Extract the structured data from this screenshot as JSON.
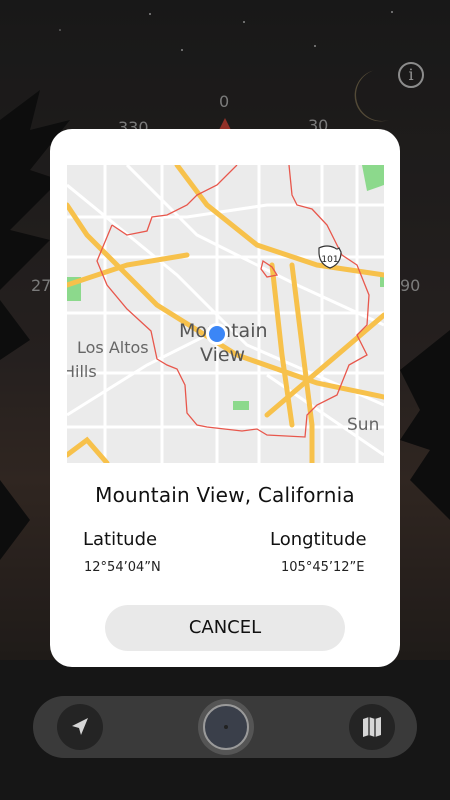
{
  "background": {
    "compass_ticks": [
      "0",
      "330",
      "30",
      "27",
      "90"
    ]
  },
  "info_icon": "info-icon",
  "dialog": {
    "map": {
      "labels": [
        "Mountain",
        "View",
        "Los Altos",
        "Hills",
        "Sun"
      ],
      "shield": "101"
    },
    "location_title": "Mountain View, California",
    "latitude_label": "Latitude",
    "latitude_value": "12°54’04”N",
    "longitude_label": "Longtitude",
    "longitude_value": "105°45’12”E",
    "cancel_label": "CANCEL"
  },
  "navbar": {
    "left_icon": "navigation-arrow-icon",
    "center_icon": "compass-icon",
    "right_icon": "map-icon"
  },
  "colors": {
    "road_major": "#f7c14b",
    "boundary": "#e8574c",
    "park": "#8cd98c",
    "location_dot": "#3b86f6"
  }
}
